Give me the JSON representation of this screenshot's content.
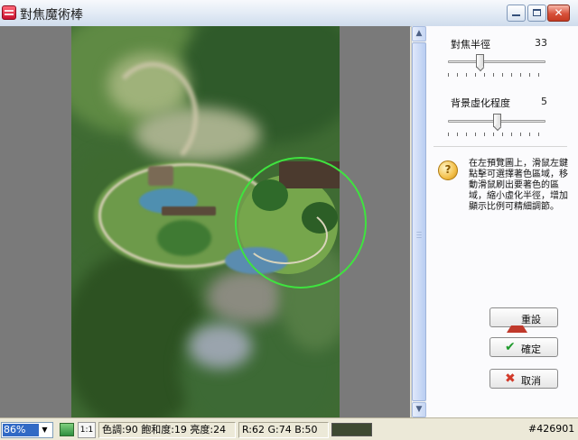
{
  "window": {
    "title": "對焦魔術棒",
    "min_label": "_",
    "max_label": "",
    "close_label": "✕"
  },
  "panel": {
    "focus_radius": {
      "label": "對焦半徑",
      "value": "33",
      "level": 0.33
    },
    "blur_level": {
      "label": "背景虛化程度",
      "value": "5",
      "level": 0.5
    },
    "hint": "在左預覽圖上，滑鼠左鍵點擊可選擇著色區域，移動滑鼠刷出要著色的區域，縮小虛化半徑，增加顯示比例可精細調節。",
    "reset_label": "重設",
    "ok_label": "確定",
    "cancel_label": "取消"
  },
  "status": {
    "zoom": "86%",
    "one_to_one": "1:1",
    "hsl": "色調:90 飽和度:19 亮度:24",
    "rgb": "R:62 G:74 B:50",
    "swatch_color": "#3e4a32",
    "watermark": "#426901"
  },
  "icons": {
    "app": "app-icon",
    "hint": "help-wizard-icon",
    "reset": "up-arrow-icon",
    "ok": "check-icon",
    "cancel": "cross-icon",
    "fit": "fit-to-window-icon"
  }
}
